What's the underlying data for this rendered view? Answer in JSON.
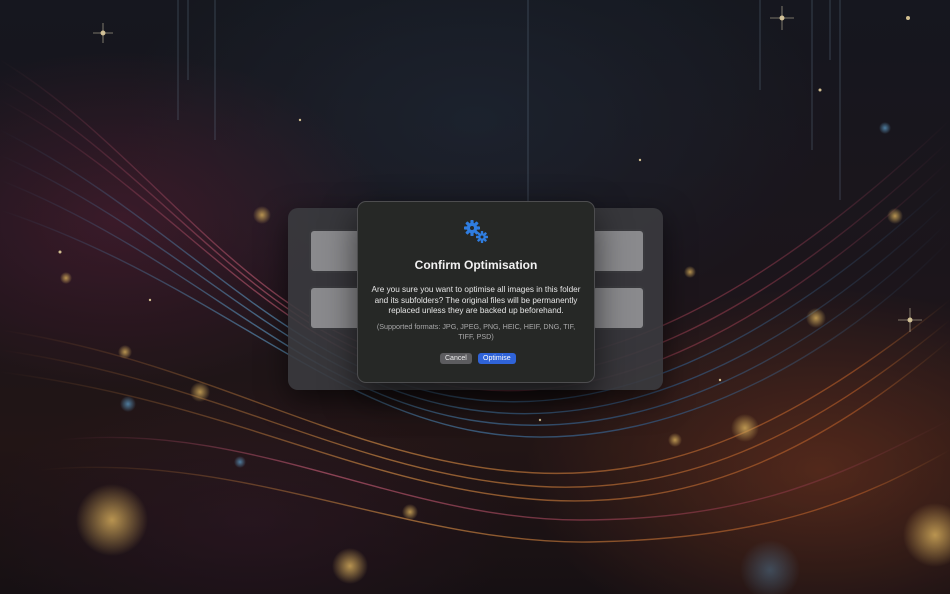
{
  "dialog": {
    "icon": "gears-icon",
    "title": "Confirm Optimisation",
    "message": "Are you sure you want to optimise all images in this folder and its subfolders? The original files will be permanently replaced unless they are backed up beforehand.",
    "formats_note": "(Supported formats: JPG, JPEG, PNG, HEIC, HEIF, DNG, TIF, TIFF, PSD)",
    "cancel_label": "Cancel",
    "confirm_label": "Optimise"
  },
  "colors": {
    "accent": "#2f63d8",
    "dialog_bg": "#262826",
    "icon": "#2f7de0"
  }
}
